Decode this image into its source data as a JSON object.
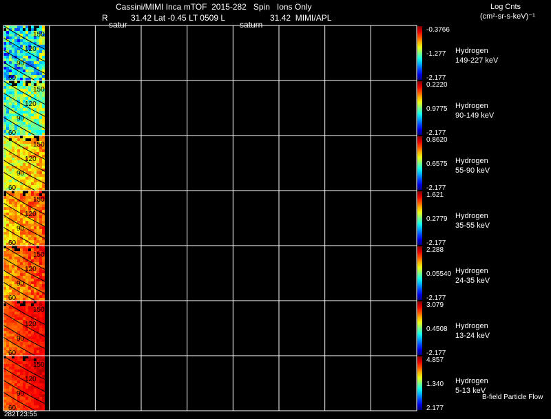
{
  "header": {
    "title": "Cassini/MIMI Inca mTOF  2015-282   Spin   Ions Only",
    "r_label": "R",
    "r_value": "31.42 Lat -0.45 LT 0509 L",
    "l_value": "31.42  MIMI/APL",
    "saturn_left": "satur",
    "saturn_right": "saturn",
    "units_line1": "Log Cnts",
    "units_line2": "(cm²-sr-s-keV)⁻¹"
  },
  "footer": {
    "time_label": "282T23:55",
    "bfield_label": "B-field Particle Flow"
  },
  "chart_data": {
    "type": "heatmap",
    "panels": [
      {
        "species": "Hydrogen",
        "energy": "149-227 keV",
        "cb_max": "-0.3766",
        "cb_mid": "-1.277",
        "cb_min": "-2.177",
        "level": 0.35,
        "noise": 0.45
      },
      {
        "species": "Hydrogen",
        "energy": "90-149 keV",
        "cb_max": "0.2220",
        "cb_mid": "0.9775",
        "cb_min": "-2.177",
        "level": 0.45,
        "noise": 0.3
      },
      {
        "species": "Hydrogen",
        "energy": "55-90 keV",
        "cb_max": "0.8620",
        "cb_mid": "0.6575",
        "cb_min": "-2.177",
        "level": 0.62,
        "noise": 0.22
      },
      {
        "species": "Hydrogen",
        "energy": "35-55 keV",
        "cb_max": "1.621",
        "cb_mid": "0.2779",
        "cb_min": "-2.177",
        "level": 0.7,
        "noise": 0.18
      },
      {
        "species": "Hydrogen",
        "energy": "24-35 keV",
        "cb_max": "2.288",
        "cb_mid": "0.05540",
        "cb_min": "-2.177",
        "level": 0.74,
        "noise": 0.16
      },
      {
        "species": "Hydrogen",
        "energy": "13-24 keV",
        "cb_max": "3.079",
        "cb_mid": "0.4508",
        "cb_min": "-2.177",
        "level": 0.8,
        "noise": 0.1
      },
      {
        "species": "Hydrogen",
        "energy": "5-13 keV",
        "cb_max": "4.857",
        "cb_mid": "1.340",
        "cb_min": "2.177",
        "level": 0.82,
        "noise": 0.08
      }
    ],
    "pitch_labels": [
      "150",
      "120",
      "90",
      "60"
    ],
    "grid_columns": 9
  }
}
